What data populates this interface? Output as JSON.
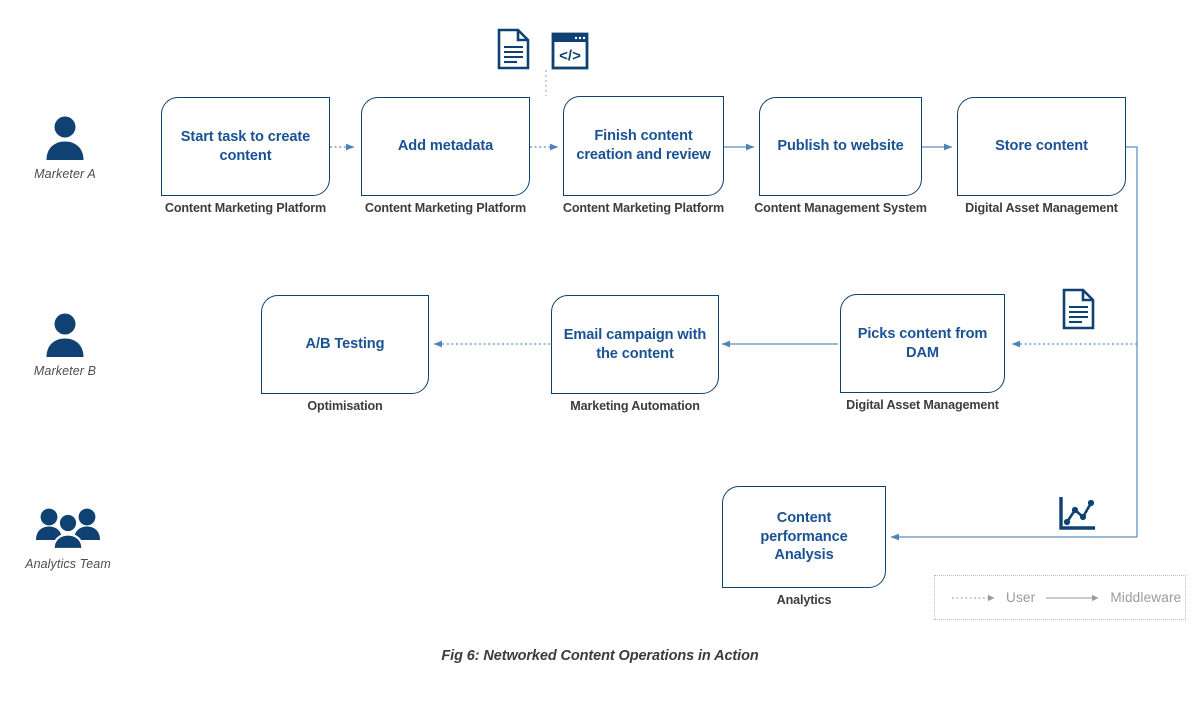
{
  "figure": {
    "caption": "Fig 6: Networked Content Operations in Action"
  },
  "colors": {
    "node_border": "#10416e",
    "node_text": "#1a5293",
    "icon_fill": "#0f4272",
    "connector_solid": "#5b8fc4",
    "connector_dotted": "#5b8fc4",
    "sublabel": "#3d3d3d",
    "actor_caption": "#4d4d4d",
    "legend_text": "#9a9a9a"
  },
  "actors": [
    {
      "id": "marketer-a",
      "label": "Marketer A",
      "icon": "person-icon"
    },
    {
      "id": "marketer-b",
      "label": "Marketer B",
      "icon": "person-icon"
    },
    {
      "id": "analytics-team",
      "label": "Analytics Team",
      "icon": "people-group-icon"
    }
  ],
  "nodes": [
    {
      "id": "start-task",
      "title": "Start task to create content",
      "sublabel": "Content  Marketing Platform"
    },
    {
      "id": "add-metadata",
      "title": "Add metadata",
      "sublabel": "Content  Marketing Platform"
    },
    {
      "id": "finish-content",
      "title": "Finish content creation and review",
      "sublabel": "Content  Marketing Platform"
    },
    {
      "id": "publish-website",
      "title": "Publish to website",
      "sublabel": "Content  Management System"
    },
    {
      "id": "store-content",
      "title": "Store content",
      "sublabel": "Digital Asset Management"
    },
    {
      "id": "ab-testing",
      "title": "A/B Testing",
      "sublabel": "Optimisation"
    },
    {
      "id": "email-campaign",
      "title": "Email campaign with the content",
      "sublabel": "Marketing Automation"
    },
    {
      "id": "picks-content",
      "title": "Picks content from DAM",
      "sublabel": "Digital Asset Management"
    },
    {
      "id": "content-performance",
      "title": "Content performance Analysis",
      "sublabel": "Analytics"
    }
  ],
  "icons": [
    {
      "id": "document-top",
      "name": "document-icon"
    },
    {
      "id": "code-window",
      "name": "code-window-icon"
    },
    {
      "id": "document-right",
      "name": "document-icon"
    },
    {
      "id": "line-chart",
      "name": "line-chart-icon"
    }
  ],
  "legend": {
    "entries": [
      {
        "id": "legend-user",
        "label": "User",
        "style": "dotted"
      },
      {
        "id": "legend-middleware",
        "label": "Middleware",
        "style": "solid"
      }
    ]
  },
  "connectors": [
    {
      "id": "start-to-metadata",
      "from": "start-task",
      "to": "add-metadata",
      "style": "dotted"
    },
    {
      "id": "metadata-to-finish",
      "from": "add-metadata",
      "to": "finish-content",
      "style": "dotted"
    },
    {
      "id": "finish-to-publish",
      "from": "finish-content",
      "to": "publish-website",
      "style": "solid"
    },
    {
      "id": "publish-to-store",
      "from": "publish-website",
      "to": "store-content",
      "style": "solid"
    },
    {
      "id": "store-to-picks",
      "from": "store-content",
      "to": "picks-content",
      "style": "dotted"
    },
    {
      "id": "store-to-performance",
      "from": "store-content",
      "to": "content-performance",
      "style": "solid"
    },
    {
      "id": "picks-to-email",
      "from": "picks-content",
      "to": "email-campaign",
      "style": "solid"
    },
    {
      "id": "email-to-abtesting",
      "from": "email-campaign",
      "to": "ab-testing",
      "style": "dotted"
    }
  ]
}
